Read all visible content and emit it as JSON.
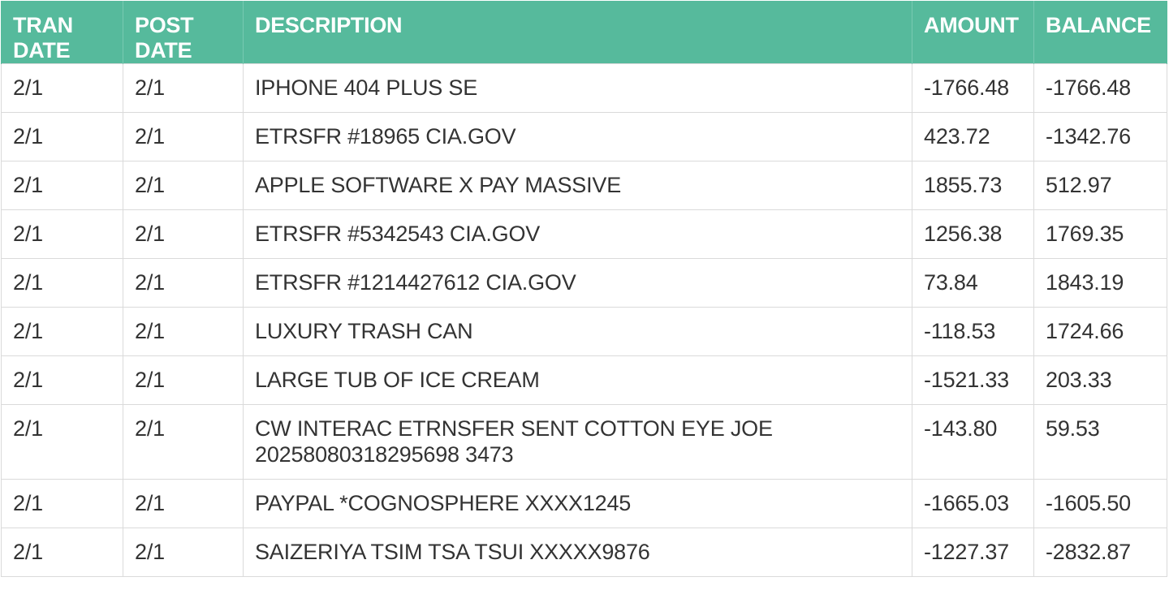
{
  "columns": {
    "tran_date": [
      "TRAN",
      "DATE"
    ],
    "post_date": [
      "POST",
      "DATE"
    ],
    "description": "DESCRIPTION",
    "amount": "AMOUNT",
    "balance": "BALANCE"
  },
  "header_color": "#56ba9c",
  "rows": [
    {
      "tran_date": "2/1",
      "post_date": "2/1",
      "description": "IPHONE 404 PLUS SE",
      "amount": "-1766.48",
      "balance": "-1766.48"
    },
    {
      "tran_date": "2/1",
      "post_date": "2/1",
      "description": "ETRSFR #18965 CIA.GOV",
      "amount": "423.72",
      "balance": "-1342.76"
    },
    {
      "tran_date": "2/1",
      "post_date": "2/1",
      "description": "APPLE SOFTWARE X PAY MASSIVE",
      "amount": "1855.73",
      "balance": "512.97"
    },
    {
      "tran_date": "2/1",
      "post_date": "2/1",
      "description": "ETRSFR #5342543 CIA.GOV",
      "amount": "1256.38",
      "balance": "1769.35"
    },
    {
      "tran_date": "2/1",
      "post_date": "2/1",
      "description": "ETRSFR #1214427612 CIA.GOV",
      "amount": "73.84",
      "balance": "1843.19"
    },
    {
      "tran_date": "2/1",
      "post_date": "2/1",
      "description": "LUXURY TRASH CAN",
      "amount": "-118.53",
      "balance": "1724.66"
    },
    {
      "tran_date": "2/1",
      "post_date": "2/1",
      "description": "LARGE TUB OF ICE CREAM",
      "amount": "-1521.33",
      "balance": "203.33"
    },
    {
      "tran_date": "2/1",
      "post_date": "2/1",
      "description": "CW INTERAC ETRNSFER SENT COTTON EYE JOE 20258080318295698 3473",
      "amount": "-143.80",
      "balance": "59.53"
    },
    {
      "tran_date": "2/1",
      "post_date": "2/1",
      "description": "PAYPAL *COGNOSPHERE XXXX1245",
      "amount": "-1665.03",
      "balance": "-1605.50"
    },
    {
      "tran_date": "2/1",
      "post_date": "2/1",
      "description": "SAIZERIYA TSIM TSA TSUI XXXXX9876",
      "amount": "-1227.37",
      "balance": "-2832.87"
    }
  ]
}
